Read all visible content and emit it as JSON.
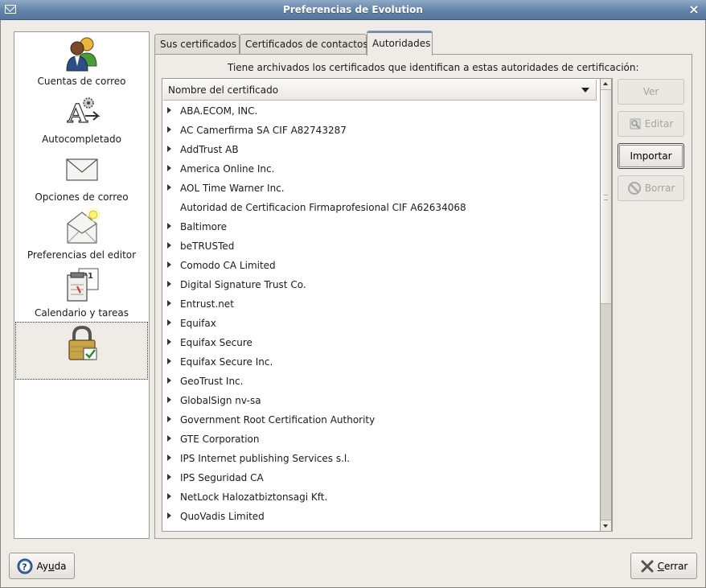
{
  "window": {
    "title": "Preferencias de Evolution",
    "close_glyph": "×"
  },
  "sidebar": {
    "items": [
      {
        "label": "Cuentas de correo",
        "icon": "accounts-people-icon"
      },
      {
        "label": "Autocompletado",
        "icon": "autocomplete-icon"
      },
      {
        "label": "Opciones de correo",
        "icon": "mail-envelope-icon"
      },
      {
        "label": "Preferencias del editor",
        "icon": "composer-envelope-icon"
      },
      {
        "label": "Calendario y tareas",
        "icon": "calendar-icon"
      },
      {
        "label": "Certificados",
        "icon": "certificates-lock-icon",
        "selected": true
      }
    ]
  },
  "tabs": [
    {
      "label": "Sus certificados"
    },
    {
      "label": "Certificados de contactos"
    },
    {
      "label": "Autoridades",
      "active": true
    }
  ],
  "authorities": {
    "intro": "Tiene archivados los certificados que identifican a estas autoridades de certificación:",
    "column_header": "Nombre del certificado",
    "rows": [
      {
        "name": "ABA.ECOM, INC.",
        "expandable": true
      },
      {
        "name": "AC Camerfirma SA CIF A82743287",
        "expandable": true
      },
      {
        "name": "AddTrust AB",
        "expandable": true
      },
      {
        "name": "America Online Inc.",
        "expandable": true
      },
      {
        "name": "AOL Time Warner Inc.",
        "expandable": true
      },
      {
        "name": "Autoridad de Certificacion Firmaprofesional CIF A62634068",
        "expandable": false
      },
      {
        "name": "Baltimore",
        "expandable": true
      },
      {
        "name": "beTRUSTed",
        "expandable": true
      },
      {
        "name": "Comodo CA Limited",
        "expandable": true
      },
      {
        "name": "Digital Signature Trust Co.",
        "expandable": true
      },
      {
        "name": "Entrust.net",
        "expandable": true
      },
      {
        "name": "Equifax",
        "expandable": true
      },
      {
        "name": "Equifax Secure",
        "expandable": true
      },
      {
        "name": "Equifax Secure Inc.",
        "expandable": true
      },
      {
        "name": "GeoTrust Inc.",
        "expandable": true
      },
      {
        "name": "GlobalSign nv-sa",
        "expandable": true
      },
      {
        "name": "Government Root Certification Authority",
        "expandable": true
      },
      {
        "name": "GTE Corporation",
        "expandable": true
      },
      {
        "name": "IPS Internet publishing Services s.l.",
        "expandable": true
      },
      {
        "name": "IPS Seguridad CA",
        "expandable": true
      },
      {
        "name": "NetLock Halozatbiztonsagi Kft.",
        "expandable": true
      },
      {
        "name": "QuoVadis Limited",
        "expandable": true
      }
    ],
    "buttons": {
      "view": {
        "label": "Ver",
        "enabled": false
      },
      "edit": {
        "label": "Editar",
        "enabled": false
      },
      "import": {
        "label": "Importar",
        "enabled": true
      },
      "delete": {
        "label": "Borrar",
        "enabled": false
      }
    }
  },
  "footer": {
    "help": {
      "label_pre": "Ay",
      "label_mnemonic": "u",
      "label_post": "da"
    },
    "close": {
      "label_pre": "",
      "label_mnemonic": "C",
      "label_post": "errar"
    }
  }
}
